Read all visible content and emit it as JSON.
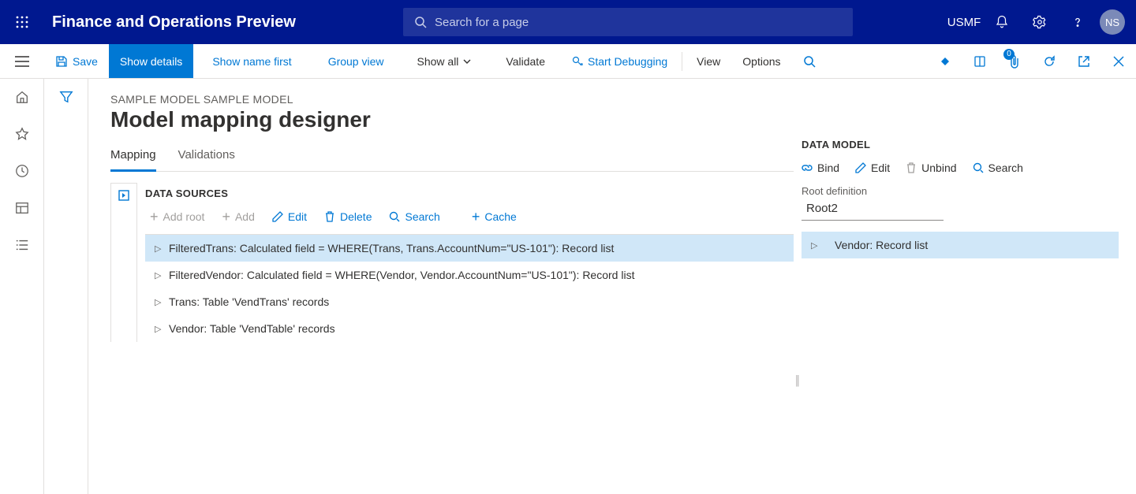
{
  "top": {
    "app_title": "Finance and Operations Preview",
    "search_placeholder": "Search for a page",
    "company": "USMF",
    "avatar": "NS"
  },
  "actionbar": {
    "save": "Save",
    "show_details": "Show details",
    "show_name_first": "Show name first",
    "group_view": "Group view",
    "show_all": "Show all",
    "validate": "Validate",
    "start_debugging": "Start Debugging",
    "view": "View",
    "options": "Options",
    "badge": "0"
  },
  "page": {
    "breadcrumb": "SAMPLE MODEL SAMPLE MODEL",
    "title": "Model mapping designer",
    "tabs": {
      "mapping": "Mapping",
      "validations": "Validations"
    }
  },
  "ds": {
    "heading": "DATA SOURCES",
    "toolbar": {
      "add_root": "Add root",
      "add": "Add",
      "edit": "Edit",
      "delete": "Delete",
      "search": "Search",
      "cache": "Cache"
    },
    "rows": [
      "FilteredTrans: Calculated field = WHERE(Trans, Trans.AccountNum=\"US-101\"): Record list",
      "FilteredVendor: Calculated field = WHERE(Vendor, Vendor.AccountNum=\"US-101\"): Record list",
      "Trans: Table 'VendTrans' records",
      "Vendor: Table 'VendTable' records"
    ]
  },
  "dm": {
    "heading": "DATA MODEL",
    "toolbar": {
      "bind": "Bind",
      "edit": "Edit",
      "unbind": "Unbind",
      "search": "Search"
    },
    "root_label": "Root definition",
    "root_value": "Root2",
    "rows": [
      "Vendor: Record list"
    ]
  }
}
